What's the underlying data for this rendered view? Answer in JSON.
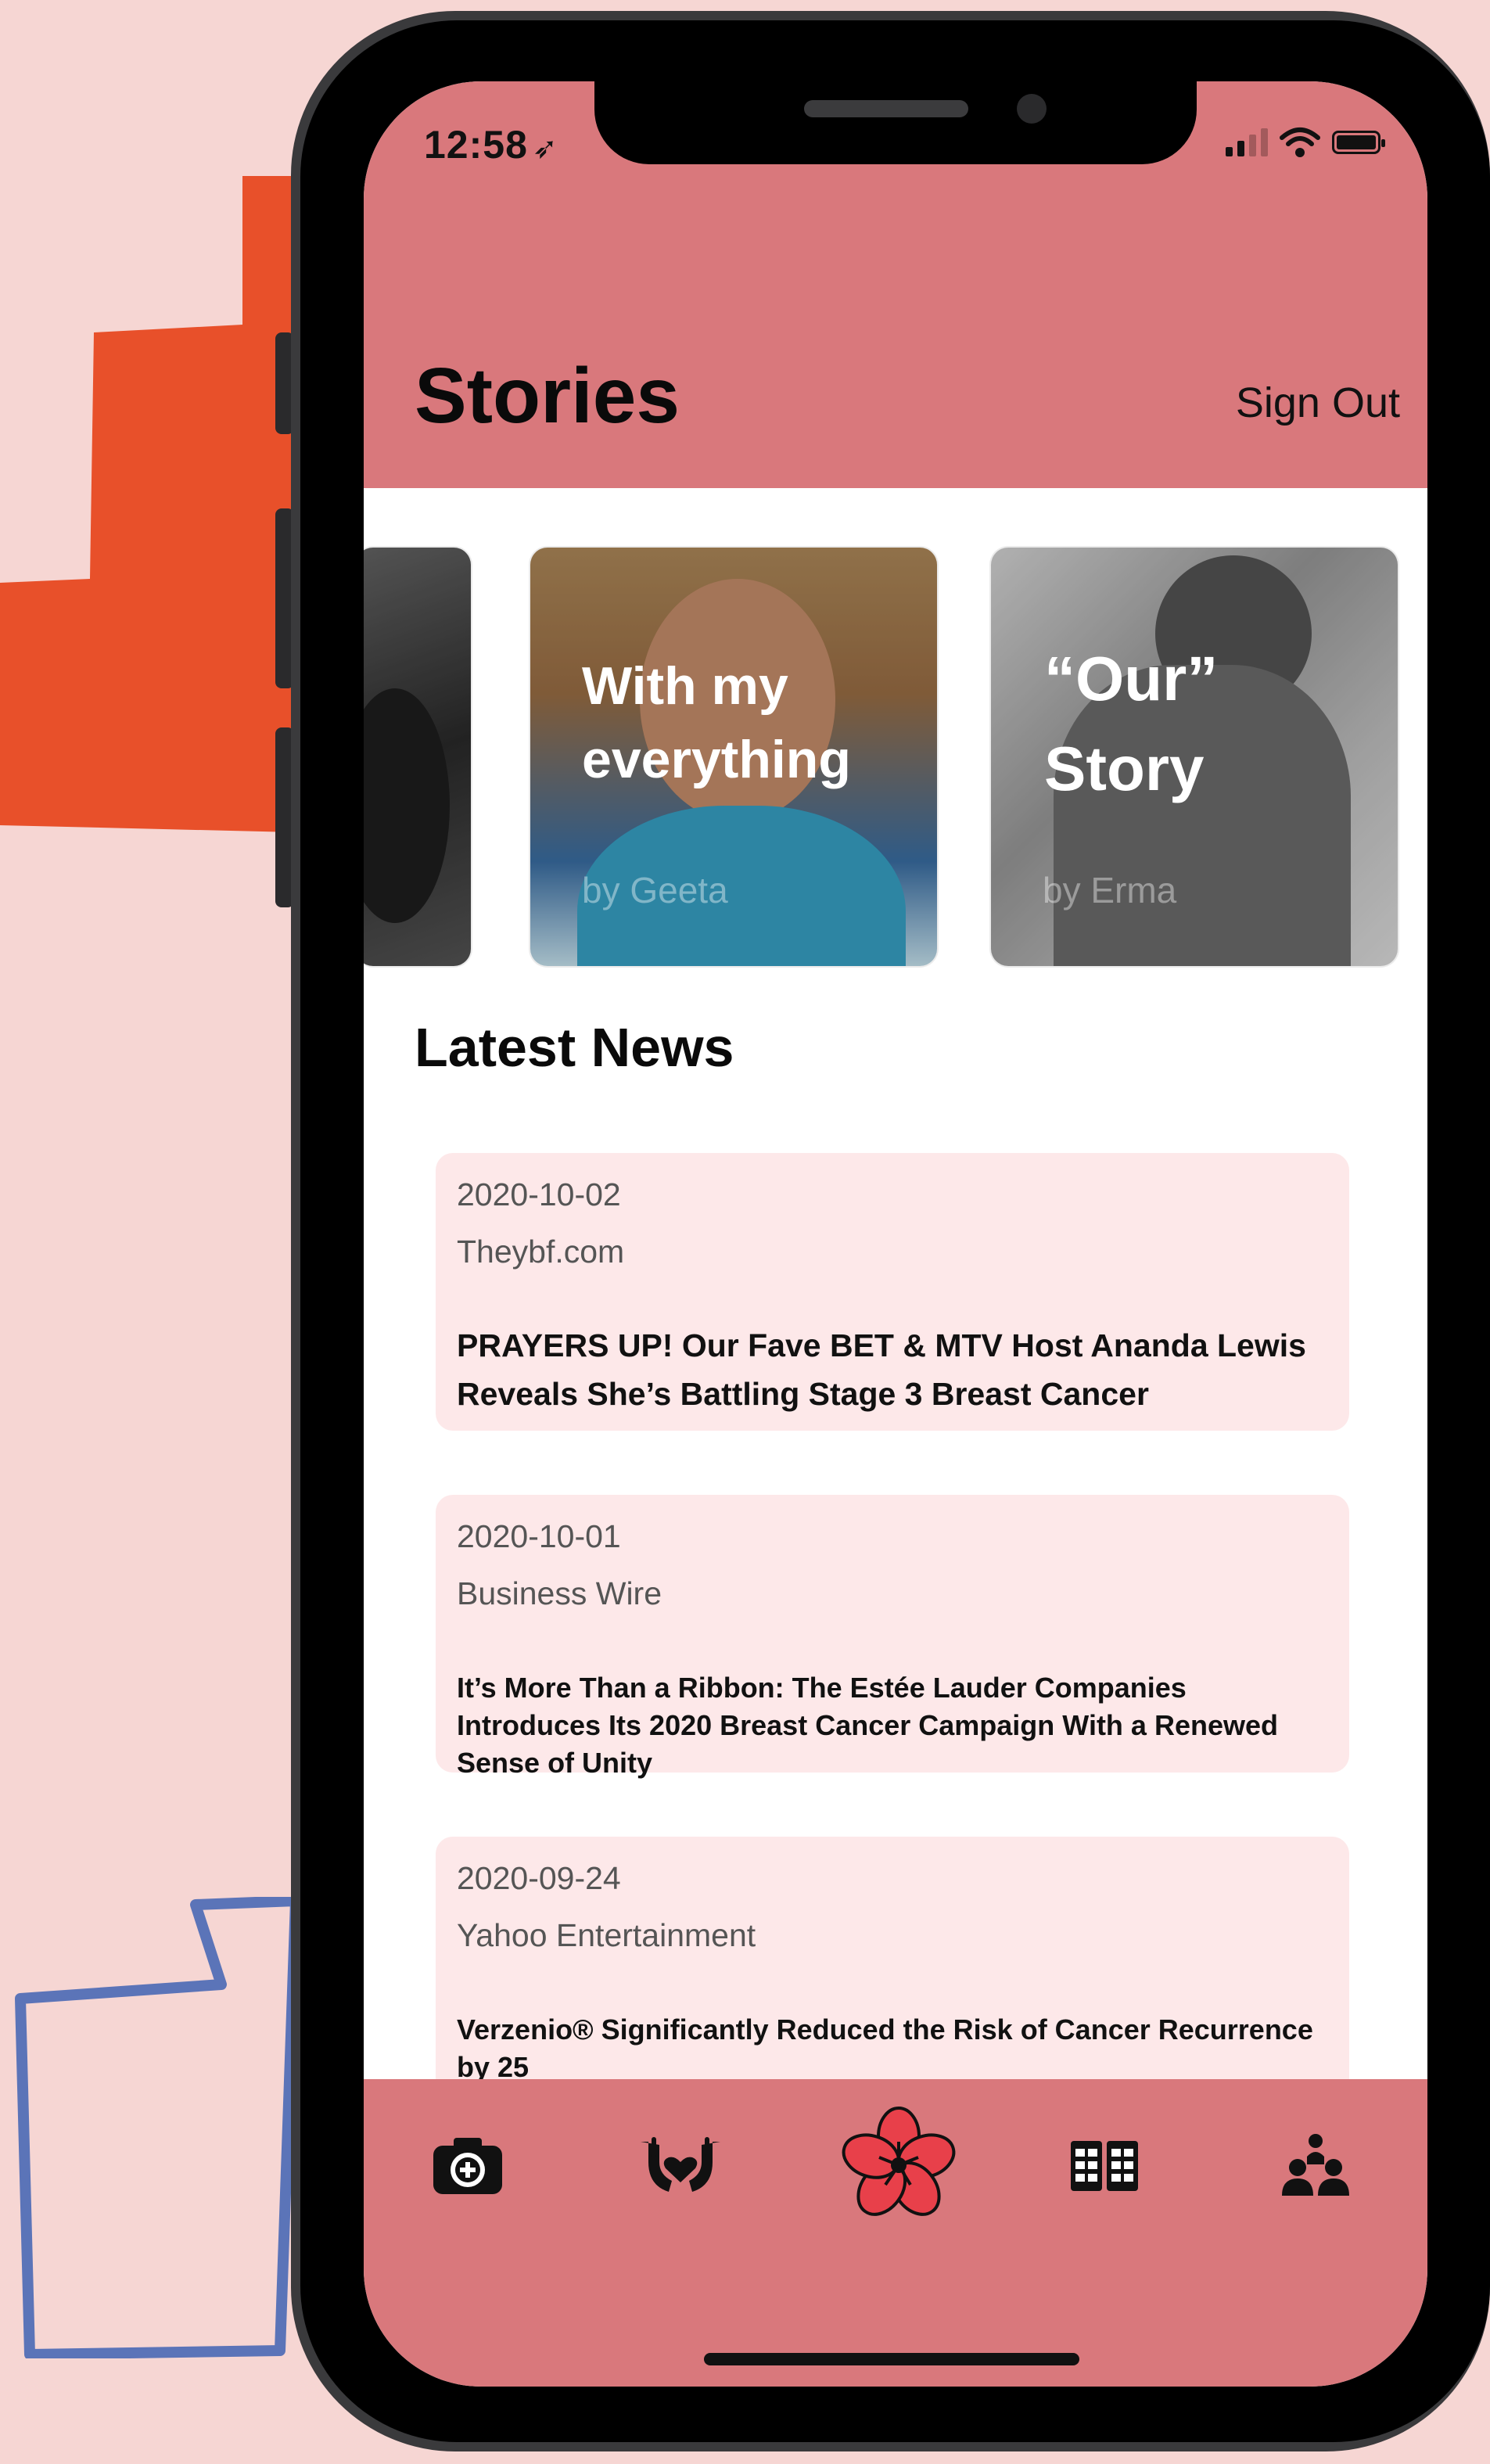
{
  "status_bar": {
    "time": "12:58",
    "location_arrow": "location-arrow-icon"
  },
  "header": {
    "title": "Stories",
    "sign_out_label": "Sign Out"
  },
  "stories": [
    {
      "title": "",
      "author": ""
    },
    {
      "title": "With my everything",
      "author": "by Geeta"
    },
    {
      "title": "“Our” Story",
      "author": "by Erma"
    }
  ],
  "latest_news": {
    "heading": "Latest News",
    "items": [
      {
        "date": "2020-10-02",
        "source": "Theybf.com",
        "headline": "PRAYERS UP! Our Fave BET & MTV Host Ananda Lewis Reveals She’s Battling Stage 3 Breast Cancer"
      },
      {
        "date": "2020-10-01",
        "source": "Business Wire",
        "headline": "It’s More Than a Ribbon: The Estée Lauder Companies Introduces Its 2020 Breast Cancer Campaign With a Renewed Sense of Unity"
      },
      {
        "date": "2020-09-24",
        "source": "Yahoo Entertainment",
        "headline": "Verzenio® Significantly Reduced the Risk of Cancer Recurrence by 25"
      }
    ]
  },
  "tab_bar": {
    "tabs": [
      {
        "icon": "camera-add-icon"
      },
      {
        "icon": "hands-heart-icon"
      },
      {
        "icon": "flower-icon",
        "active": true
      },
      {
        "icon": "book-icon"
      },
      {
        "icon": "people-icon"
      }
    ]
  },
  "colors": {
    "header_bg": "#d9787c",
    "card_bg": "#fde8e9",
    "page_bg": "#f6d6d3",
    "deco_orange": "#e8502a",
    "deco_blue": "#5b74b8",
    "flower_active": "#e8404a"
  }
}
